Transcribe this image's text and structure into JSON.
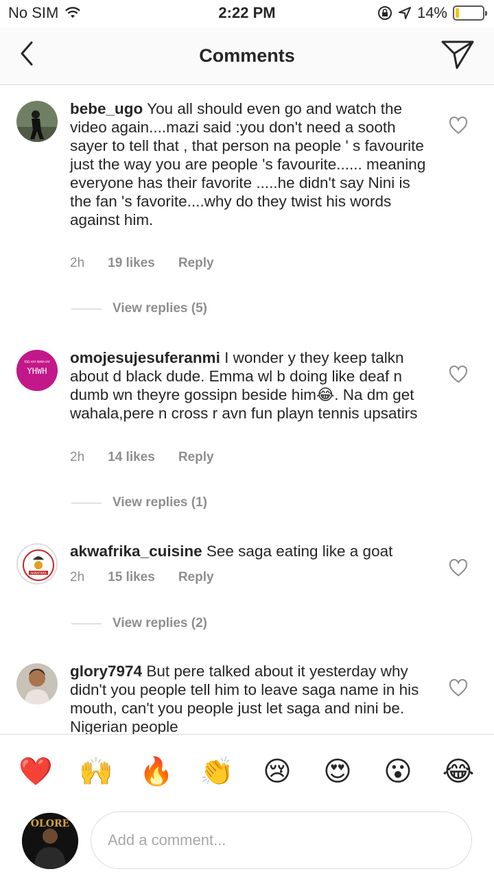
{
  "status": {
    "carrier": "No SIM",
    "time": "2:22 PM",
    "battery": "14%",
    "battery_level": 0.14
  },
  "header": {
    "title": "Comments"
  },
  "comments": [
    {
      "username": "bebe_ugo",
      "text": "You all should even go and watch the video again....mazi said :you don't need a sooth sayer to tell that , that person na people ' s favourite just the way you are people 's favourite...... meaning everyone has their favorite .....he didn't say Nini is the fan 's favorite....why do they twist his words against him.",
      "time": "2h",
      "likes": "19 likes",
      "reply": "Reply",
      "view_replies": "View replies (5)"
    },
    {
      "username": "omojesujesuferanmi",
      "text": "I wonder y they keep talkn about d black dude. Emma wl b doing like deaf n dumb wn theyre gossipn beside him😂. Na dm get wahala,pere n cross r avn fun playn tennis upsatirs",
      "avatar_text": "YHWH",
      "avatar_subtext": "YOD·HAY·WAW·HAY",
      "time": "2h",
      "likes": "14 likes",
      "reply": "Reply",
      "view_replies": "View replies (1)"
    },
    {
      "username": "akwafrika_cuisine",
      "text": "See saga eating like a goat",
      "avatar_text": "AKWAFRIKA",
      "time": "2h",
      "likes": "15 likes",
      "reply": "Reply",
      "view_replies": "View replies (2)"
    },
    {
      "username": "glory7974",
      "text": "But pere talked about it yesterday why didn't you people tell him to leave saga name in his mouth, can't you  people just let saga and nini be. Nigerian people"
    }
  ],
  "emojis": [
    "❤️",
    "🙌",
    "🔥",
    "👏",
    "😢",
    "😍",
    "😮",
    "😂"
  ],
  "composer": {
    "placeholder": "Add a comment...",
    "avatar_text": "OLORE"
  },
  "colors": {
    "text": "#262626",
    "secondary": "#8e8e8e",
    "border": "#dbdbdb",
    "battery": "#f5c400",
    "avatar2": "#c2188a"
  }
}
